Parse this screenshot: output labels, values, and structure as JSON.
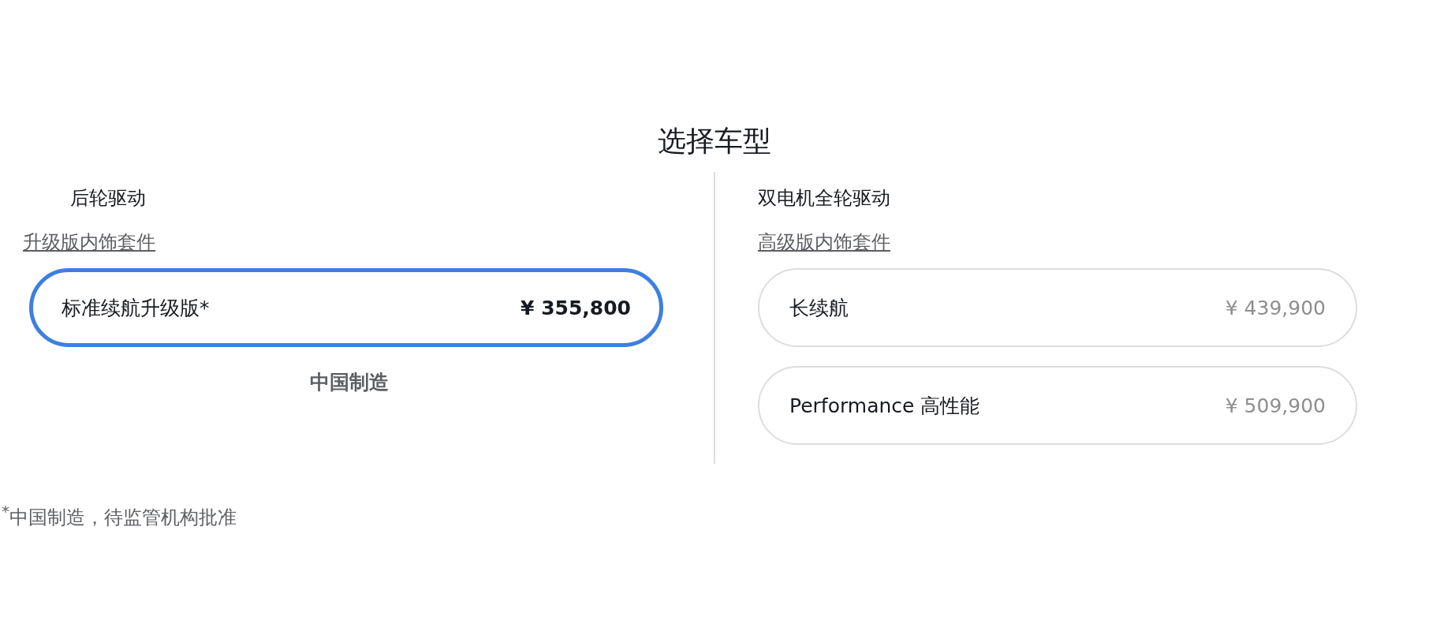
{
  "title": "选择车型",
  "groups": [
    {
      "drive": "后轮驱动",
      "link": "升级版内饰套件",
      "options": [
        {
          "name": "标准续航升级版*",
          "price": "¥ 355,800",
          "selected": true
        }
      ],
      "note": "中国制造"
    },
    {
      "drive": "双电机全轮驱动",
      "link": "高级版内饰套件",
      "options": [
        {
          "name": "长续航",
          "price": "¥ 439,900",
          "selected": false
        },
        {
          "name": "Performance 高性能",
          "price": "¥ 509,900",
          "selected": false
        }
      ]
    }
  ],
  "footnote": "$^{*}$中国制造，待监管机构批准"
}
